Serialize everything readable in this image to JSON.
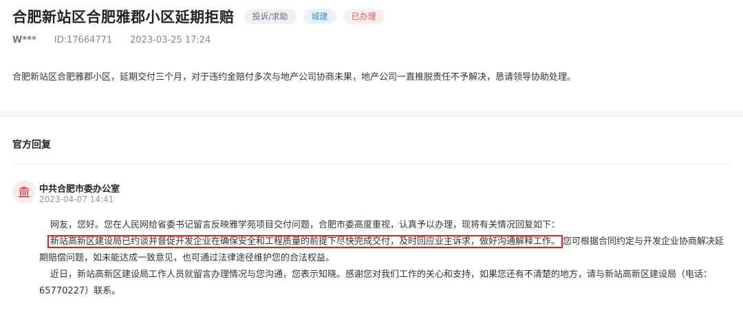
{
  "post": {
    "title": "合肥新站区合肥雅郡小区延期拒赔",
    "tags": [
      "投诉/求助",
      "城建",
      "已办理"
    ],
    "user": "W***",
    "id": "ID:17664771",
    "time": "2023-03-25 17:24",
    "content": "合肥新站区合肥雅郡小区，延期交付三个月，对于违约金赔付多次与地产公司协商未果，地产公司一直推脱责任不予解决，恳请领导协助处理。"
  },
  "reply": {
    "section_title": "官方回复",
    "org_name": "中共合肥市委办公室",
    "time": "2023-04-07 14:41",
    "p1": "网友，您好。您在人民网给省委书记留言反映雅学苑项目交付问题，合肥市委高度重视，认真予以办理，现将有关情况回复如下：",
    "p2_highlight": "新站高新区建设局已约谈并督促开发企业在确保安全和工程质量的前提下尽快完成交付，及时回应业主诉求，做好沟通解释工作。",
    "p2_rest": "您可根据合同约定与开发企业协商解决延期赔偿问题，如未能达成一致意见，也可通过法律途径维护您的合法权益。",
    "p3": "近日，新站高新区建设局工作人员就留言办理情况与您沟通，您表示知晓。感谢您对我们工作的关心和支持，如果您还有不清楚的地方，请与新站高新区建设局（电话：65770227）联系。"
  },
  "icons": {
    "org": "government-building-icon"
  },
  "colors": {
    "highlight_border": "#e02020",
    "tag_done": "#e2575c",
    "tag_category": "#3d8fc4"
  }
}
